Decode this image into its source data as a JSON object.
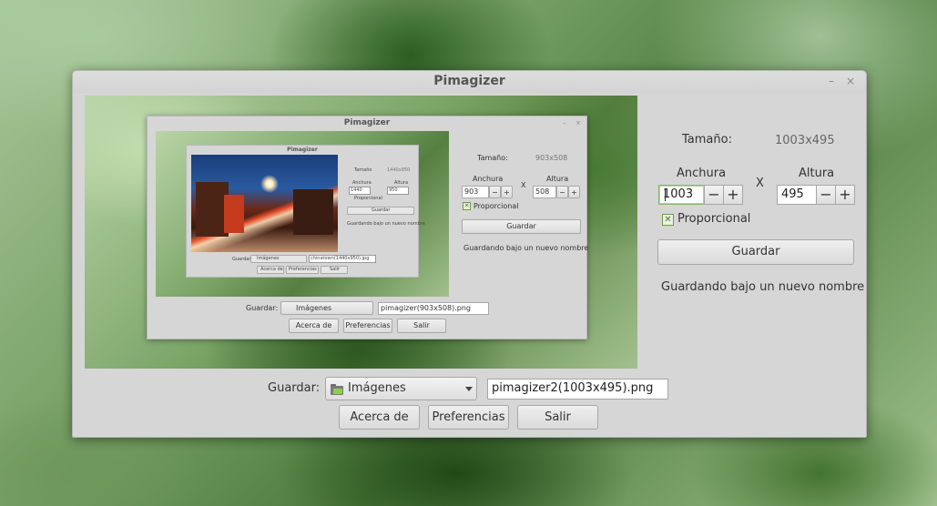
{
  "window": {
    "title": "Pimagizer"
  },
  "titlebar": {
    "minimize_glyph": "–",
    "close_glyph": "×"
  },
  "size": {
    "label": "Tamaño:",
    "value": "1003x495"
  },
  "dimensions": {
    "width_label": "Anchura",
    "height_label": "Altura",
    "separator": "X",
    "width_value": "1003",
    "height_value": "495",
    "decrement_glyph": "−",
    "increment_glyph": "+"
  },
  "proportional": {
    "label": "Proporcional",
    "checked": true,
    "check_glyph": "✕"
  },
  "save_button": "Guardar",
  "status": "Guardando bajo un nuevo nombre",
  "footer": {
    "save_label": "Guardar:",
    "folder": "Imágenes",
    "filename": "pimagizer2(1003x495).png",
    "about": "Acerca de",
    "preferences": "Preferencias",
    "quit": "Salir"
  },
  "preview": {
    "nested": {
      "title": "Pimagizer",
      "size_label": "Tamaño:",
      "size_value": "903x508",
      "width_label": "Anchura",
      "height_label": "Altura",
      "separator": "X",
      "width_value": "903",
      "height_value": "508",
      "proportional": "Proporcional",
      "save_button": "Guardar",
      "status": "Guardando bajo un nuevo nombre",
      "save_label": "Guardar:",
      "folder": "Imágenes",
      "filename": "pimagizer(903x508).png",
      "about": "Acerca de",
      "preferences": "Preferencias",
      "quit": "Salir",
      "inner": {
        "title": "Pimagizer",
        "size_label": "Tamaño",
        "size_value": "1440x950",
        "width_label": "Anchura",
        "height_label": "Altura",
        "width_value": "1440",
        "height_value": "950",
        "proportional": "Proporcional",
        "save_button": "Guardar",
        "status": "Guardando bajo un nuevo nombre",
        "save_label": "Guardar:",
        "folder": "Imágenes",
        "filename": "chinatown(1440x950).jpg",
        "about": "Acerca de",
        "preferences": "Preferencias",
        "quit": "Salir"
      }
    }
  },
  "colors": {
    "window_bg": "#d6d6d6",
    "focus_border": "#8bb56b",
    "folder_accent": "#8ccf52"
  }
}
